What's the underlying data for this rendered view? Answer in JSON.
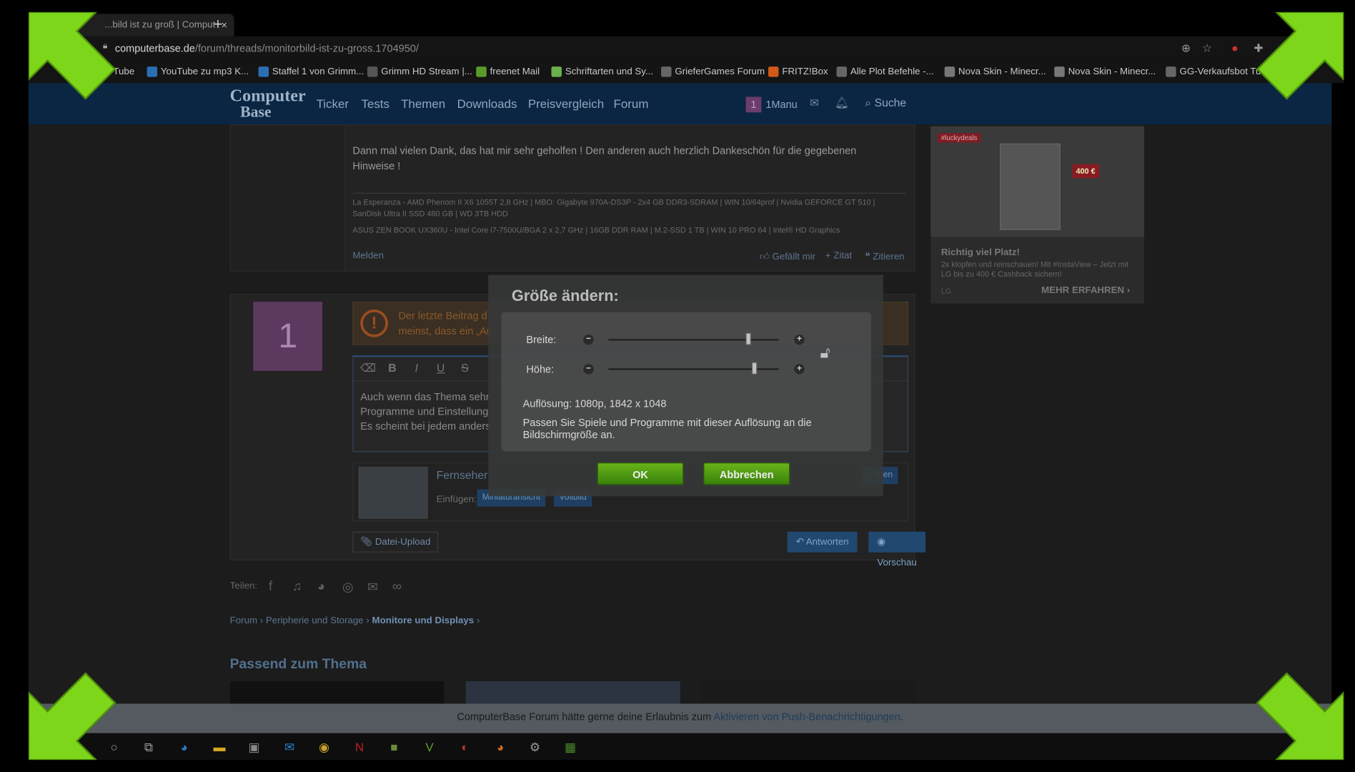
{
  "browser": {
    "tab_title": "...bild ist zu groß | Comput",
    "tab_close": "×",
    "new_tab": "+",
    "url_host": "computerbase.de",
    "url_path": "/forum/threads/monitorbild-ist-zu-gross.1704950/",
    "bookmarks": [
      {
        "label": "Tube",
        "color": "#c22"
      },
      {
        "label": "YouTube zu mp3 K...",
        "color": "#2a6fb3"
      },
      {
        "label": "Staffel 1 von Grimm...",
        "color": "#2a6fb3"
      },
      {
        "label": "Grimm HD Stream |...",
        "color": "#555"
      },
      {
        "label": "freenet Mail",
        "color": "#5a9a2a"
      },
      {
        "label": "Schriftarten und Sy...",
        "color": "#6ab04c"
      },
      {
        "label": "GrieferGames Forum",
        "color": "#666"
      },
      {
        "label": "FRITZ!Box",
        "color": "#d05a1a"
      },
      {
        "label": "Alle Plot Befehle -...",
        "color": "#666"
      },
      {
        "label": "Nova Skin - Minecr...",
        "color": "#777"
      },
      {
        "label": "Nova Skin - Minecr...",
        "color": "#777"
      },
      {
        "label": "GG-Verkaufsbot Tu",
        "color": "#666"
      }
    ]
  },
  "site": {
    "logo_top": "Computer",
    "logo_bottom": "Base",
    "nav": [
      "Ticker",
      "Tests",
      "Themen",
      "Downloads",
      "Preisvergleich",
      "Forum"
    ],
    "user_badge": "1",
    "user_name": "1Manu",
    "search_label": "Suche"
  },
  "post": {
    "text": "Dann mal vielen Dank, das hat mir sehr geholfen ! Den anderen auch herzlich Dankeschön für die gegebenen Hinweise !",
    "sig_line1": "La Esperanza - AMD Phenom II X6 1055T 2,8 GHz | MBO: Gigabyte 970A-DS3P - 2x4 GB DDR3-SDRAM | WIN 10/64prof | Nvidia GEFORCE GT 510 | SanDisk Ultra II SSD 480 GB | WD 3TB HDD",
    "sig_line2": "ASUS ZEN BOOK UX360U - Intel Core i7-7500U/BGA 2 x 2,7 GHz | 16GB DDR RAM | M.2-SSD 1 TB | WIN 10 PRO 64 | Intel® HD Graphics",
    "report": "Melden",
    "like": "Gefällt mir",
    "quote": "+ Zitat",
    "cite": "Zitieren"
  },
  "reply": {
    "avatar_letter": "1",
    "warning_line1": "Der letzte Beitrag d",
    "warning_line2": "meinst, dass ein „Au",
    "editor_line1": "Auch wenn das Thema sehr",
    "editor_line2": "Programme und Einstellung",
    "editor_line3": "Es scheint bei jedem anders",
    "attach_title": "Fernseher",
    "attach_label": "Einfügen:",
    "attach_btn1": "Miniaturansicht",
    "attach_btn2": "Vollbild",
    "attach_btn3": "...chen",
    "upload": "Datei-Upload",
    "answer": "Antworten",
    "preview": "Vorschau"
  },
  "share_label": "Teilen:",
  "breadcrumbs": [
    "Forum",
    "Peripherie und Storage",
    "Monitore und Displays"
  ],
  "related_title": "Passend zum Thema",
  "ad": {
    "tag": "#luckydeals",
    "price_tag": "400 €",
    "title": "Richtig viel Platz!",
    "text": "2x klopfen und reinschauen! Mit #InstaView – Jetzt mit LG bis zu 400 € Cashback sichern!",
    "brand": "LG",
    "cta": "MEHR ERFAHREN"
  },
  "push_bar": {
    "prefix": "ComputerBase Forum hätte gerne deine Erlaubnis zum ",
    "link": "Aktivieren von Push-Benachrichtigungen",
    "suffix": "."
  },
  "dialog": {
    "title": "Größe ändern:",
    "width_label": "Breite:",
    "height_label": "Höhe:",
    "width_level": 0.82,
    "height_level": 0.86,
    "resolution": "Auflösung: 1080p, 1842 x 1048",
    "hint": "Passen Sie Spiele und Programme mit dieser Auflösung an die Bildschirmgröße an.",
    "ok": "OK",
    "cancel": "Abbrechen",
    "minus": "−",
    "plus": "+"
  },
  "colors": {
    "arrow_green": "#7ed61a",
    "dialog_bg": "#363838",
    "button_green": "#4fa312"
  }
}
